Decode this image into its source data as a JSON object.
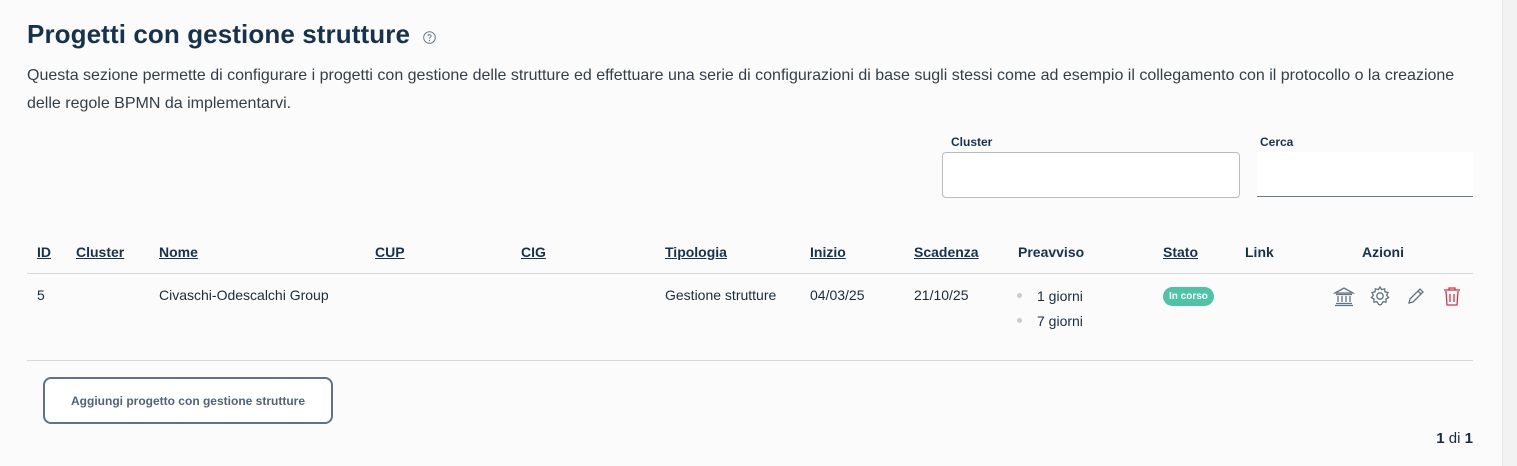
{
  "header": {
    "title": "Progetti con gestione strutture",
    "intro": "Questa sezione permette di configurare i progetti con gestione delle strutture ed effettuare una serie di configurazioni di base sugli stessi come ad esempio il collegamento con il protocollo o la creazione delle regole BPMN da implementarvi."
  },
  "filters": {
    "cluster_label": "Cluster",
    "cluster_value": "",
    "search_label": "Cerca",
    "search_value": ""
  },
  "table": {
    "columns": {
      "id": "ID",
      "cluster": "Cluster",
      "nome": "Nome",
      "cup": "CUP",
      "cig": "CIG",
      "tipologia": "Tipologia",
      "inizio": "Inizio",
      "scadenza": "Scadenza",
      "preavviso": "Preavviso",
      "stato": "Stato",
      "link": "Link",
      "azioni": "Azioni"
    },
    "rows": [
      {
        "id": "5",
        "cluster": "",
        "nome": "Civaschi-Odescalchi Group",
        "cup": "",
        "cig": "",
        "tipologia": "Gestione strutture",
        "inizio": "04/03/25",
        "scadenza": "21/10/25",
        "preavviso": [
          "1 giorni",
          "7 giorni"
        ],
        "stato": "In corso",
        "link": "",
        "actions": [
          "bank-icon",
          "gear-icon",
          "pencil-icon",
          "trash-icon"
        ]
      }
    ]
  },
  "add_button": {
    "label": "Aggiungi progetto con gestione strutture"
  },
  "pagination": {
    "current": "1",
    "separator": "di",
    "total": "1"
  },
  "colors": {
    "title": "#17324d",
    "status_badge": "#4fc3a6",
    "action_icon": "#5f7387",
    "delete_icon": "#d1344c"
  }
}
